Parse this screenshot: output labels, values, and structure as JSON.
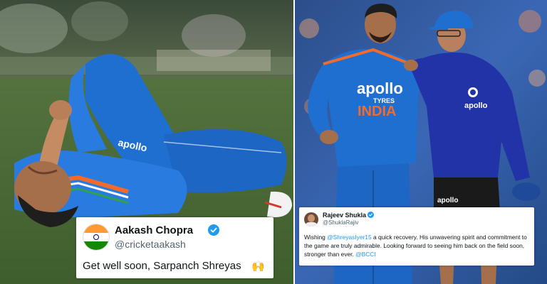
{
  "left_tweet": {
    "name": "Aakash Chopra",
    "handle": "@cricketaakash",
    "text": "Get well soon, Sarpanch Shreyas",
    "avatar_icon": "india-flag-icon",
    "verified_icon": "verified-badge-icon",
    "emoji_icon": "raising-hands-icon"
  },
  "right_tweet": {
    "name": "Rajeev Shukla",
    "handle": "@ShuklaRajiv",
    "text_1": "Wishing ",
    "mention_1": "@ShreyasIyer15",
    "text_2": " a quick recovery. His unwavering spirit and commitment to the game are truly admirable. Looking forward to seeing him back on the field soon, stronger than ever. ",
    "mention_2": "@BCCI",
    "verified_icon": "verified-badge-icon"
  },
  "jersey_text": {
    "sponsor_left_photo": "apollo",
    "sponsor_main": "apollo",
    "sponsor_sub": "TYRES",
    "team": "INDIA",
    "sponsor_jacket": "apollo",
    "sponsor_shorts": "apollo"
  },
  "colors": {
    "jersey_blue": "#1f6fd1",
    "jacket_navy": "#2233a8",
    "team_orange": "#f26b2a",
    "verified_blue": "#1d9bf0",
    "mention_blue": "#1d9bf0"
  }
}
